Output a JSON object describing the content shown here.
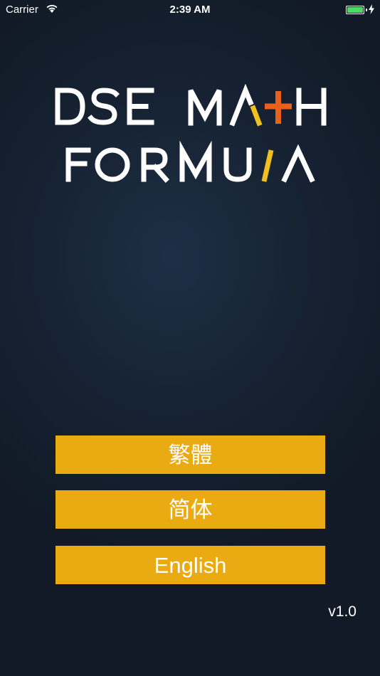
{
  "status_bar": {
    "carrier": "Carrier",
    "time": "2:39 AM",
    "icons": [
      "wifi-icon",
      "battery-icon",
      "charging-bolt-icon"
    ],
    "battery_color": "#4cd964"
  },
  "logo": {
    "line1": {
      "parts": [
        "DSE MA",
        "+",
        "H"
      ]
    },
    "line2": {
      "parts": [
        "FORMU",
        "/",
        "A"
      ]
    },
    "colors": {
      "text": "#ffffff",
      "plus": "#e8601c",
      "slash": "#f0c020",
      "accent": "#f0c020"
    }
  },
  "buttons": {
    "traditional": "繁體",
    "simplified": "简体",
    "english": "English",
    "color": "#eaaa11"
  },
  "version": "v1.0"
}
